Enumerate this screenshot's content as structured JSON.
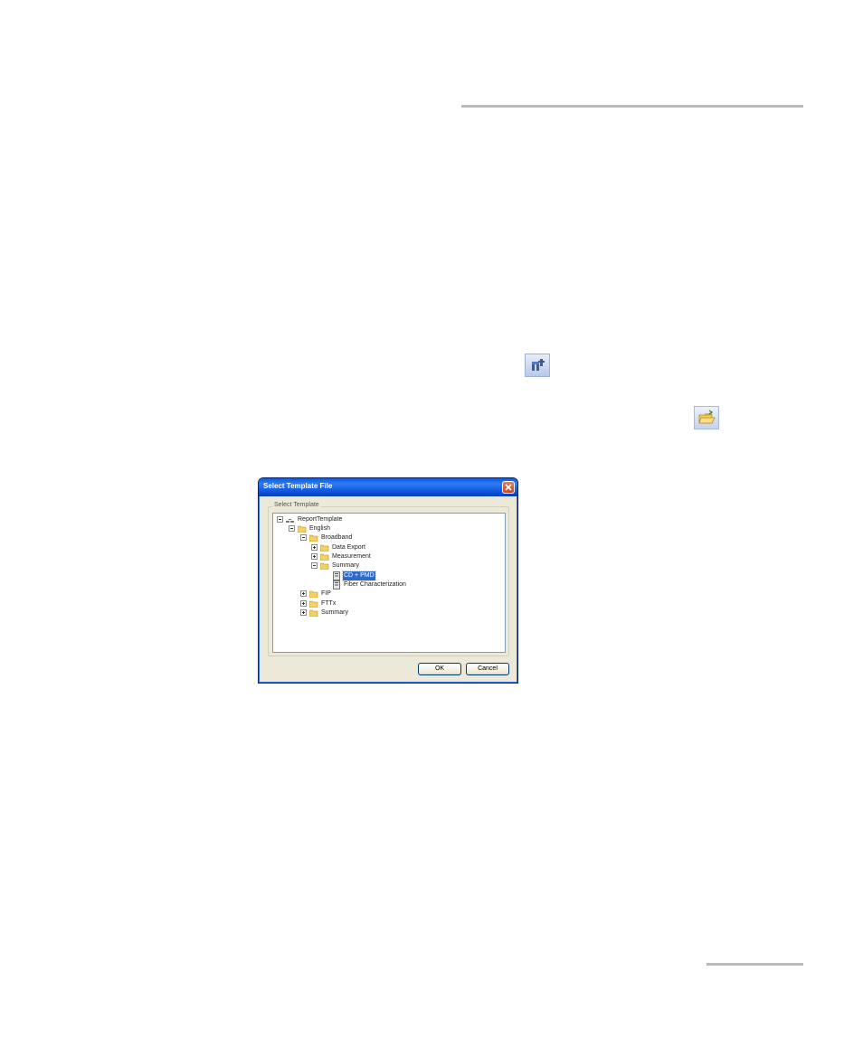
{
  "dialog": {
    "title": "Select Template File",
    "group_label": "Select Template",
    "ok_label": "OK",
    "cancel_label": "Cancel"
  },
  "tree": {
    "root": "ReportTemplate",
    "english": "English",
    "broadband": "Broadband",
    "data_export": "Data Export",
    "measurement": "Measurement",
    "summary_folder": "Summary",
    "cd_pmd": "CD + PMD",
    "fiber_char": "Fiber Characterization",
    "fip": "FIP",
    "fttx": "FTTx",
    "summary": "Summary"
  },
  "colors": {
    "titlebar": "#0a5ce0",
    "selection": "#316ac5",
    "folder": "#f2d266",
    "rule": "#b9b9b9"
  },
  "icons": {
    "toolbar_a": "find-template-icon",
    "toolbar_b": "open-folder-icon"
  }
}
